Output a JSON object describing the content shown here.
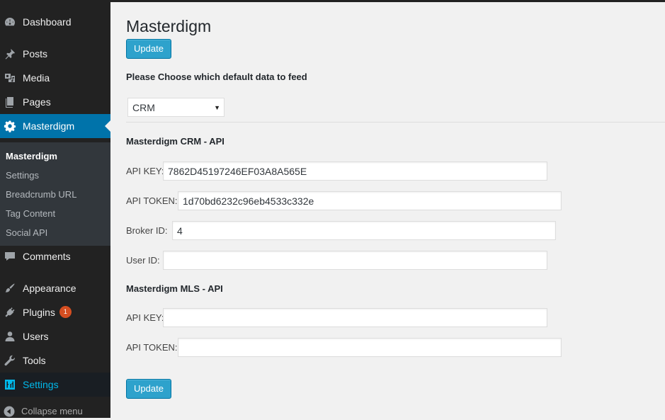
{
  "sidebar": {
    "dashboard": "Dashboard",
    "posts": "Posts",
    "media": "Media",
    "pages": "Pages",
    "masterdigm": "Masterdigm",
    "submenu": {
      "masterdigm": "Masterdigm",
      "settings": "Settings",
      "breadcrumb": "Breadcrumb URL",
      "tag_content": "Tag Content",
      "social_api": "Social API"
    },
    "comments": "Comments",
    "appearance": "Appearance",
    "plugins": "Plugins",
    "plugins_badge": "1",
    "users": "Users",
    "tools": "Tools",
    "settings": "Settings",
    "collapse": "Collapse menu"
  },
  "main": {
    "title": "Masterdigm",
    "update_label": "Update",
    "choose_label": "Please Choose which default data to feed",
    "feed_select": "CRM",
    "crm_heading": "Masterdigm CRM - API",
    "crm": {
      "api_key_label": "API KEY:",
      "api_key": "7862D45197246EF03A8A565E",
      "api_token_label": "API TOKEN:",
      "api_token": "1d70bd6232c96eb4533c332e",
      "broker_id_label": "Broker ID:",
      "broker_id": "4",
      "user_id_label": "User ID:",
      "user_id": ""
    },
    "mls_heading": "Masterdigm MLS - API",
    "mls": {
      "api_key_label": "API KEY:",
      "api_key": "",
      "api_token_label": "API TOKEN:",
      "api_token": ""
    }
  },
  "colors": {
    "sidebar_bg": "#222222",
    "submenu_bg": "#32373c",
    "current_menu": "#0073aa",
    "active_settings_text": "#00b9eb",
    "button": "#2ea2cc",
    "badge": "#d54e21"
  }
}
